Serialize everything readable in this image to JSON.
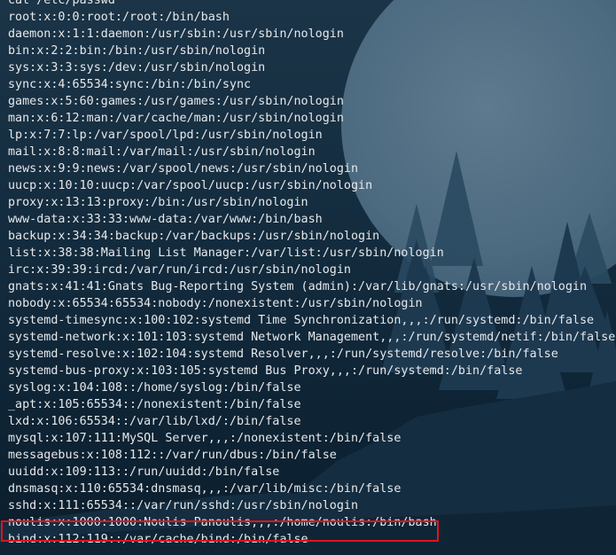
{
  "terminal": {
    "command": "cat /etc/passwd",
    "lines": [
      "root:x:0:0:root:/root:/bin/bash",
      "daemon:x:1:1:daemon:/usr/sbin:/usr/sbin/nologin",
      "bin:x:2:2:bin:/bin:/usr/sbin/nologin",
      "sys:x:3:3:sys:/dev:/usr/sbin/nologin",
      "sync:x:4:65534:sync:/bin:/bin/sync",
      "games:x:5:60:games:/usr/games:/usr/sbin/nologin",
      "man:x:6:12:man:/var/cache/man:/usr/sbin/nologin",
      "lp:x:7:7:lp:/var/spool/lpd:/usr/sbin/nologin",
      "mail:x:8:8:mail:/var/mail:/usr/sbin/nologin",
      "news:x:9:9:news:/var/spool/news:/usr/sbin/nologin",
      "uucp:x:10:10:uucp:/var/spool/uucp:/usr/sbin/nologin",
      "proxy:x:13:13:proxy:/bin:/usr/sbin/nologin",
      "www-data:x:33:33:www-data:/var/www:/bin/bash",
      "backup:x:34:34:backup:/var/backups:/usr/sbin/nologin",
      "list:x:38:38:Mailing List Manager:/var/list:/usr/sbin/nologin",
      "irc:x:39:39:ircd:/var/run/ircd:/usr/sbin/nologin",
      "gnats:x:41:41:Gnats Bug-Reporting System (admin):/var/lib/gnats:/usr/sbin/nologin",
      "nobody:x:65534:65534:nobody:/nonexistent:/usr/sbin/nologin",
      "systemd-timesync:x:100:102:systemd Time Synchronization,,,:/run/systemd:/bin/false",
      "systemd-network:x:101:103:systemd Network Management,,,:/run/systemd/netif:/bin/false",
      "systemd-resolve:x:102:104:systemd Resolver,,,:/run/systemd/resolve:/bin/false",
      "systemd-bus-proxy:x:103:105:systemd Bus Proxy,,,:/run/systemd:/bin/false",
      "syslog:x:104:108::/home/syslog:/bin/false",
      "_apt:x:105:65534::/nonexistent:/bin/false",
      "lxd:x:106:65534::/var/lib/lxd/:/bin/false",
      "mysql:x:107:111:MySQL Server,,,:/nonexistent:/bin/false",
      "messagebus:x:108:112::/var/run/dbus:/bin/false",
      "uuidd:x:109:113::/run/uuidd:/bin/false",
      "dnsmasq:x:110:65534:dnsmasq,,,:/var/lib/misc:/bin/false",
      "sshd:x:111:65534::/var/run/sshd:/usr/sbin/nologin",
      "noulis:x:1000:1000:Noulis Panoulis,,,:/home/noulis:/bin/bash",
      "bind:x:112:119::/var/cache/bind:/bin/false"
    ],
    "highlighted_line_index": 30,
    "highlight_color": "#e0141b",
    "text_color": "#e6e8ea",
    "background_color": "#0d2234"
  }
}
